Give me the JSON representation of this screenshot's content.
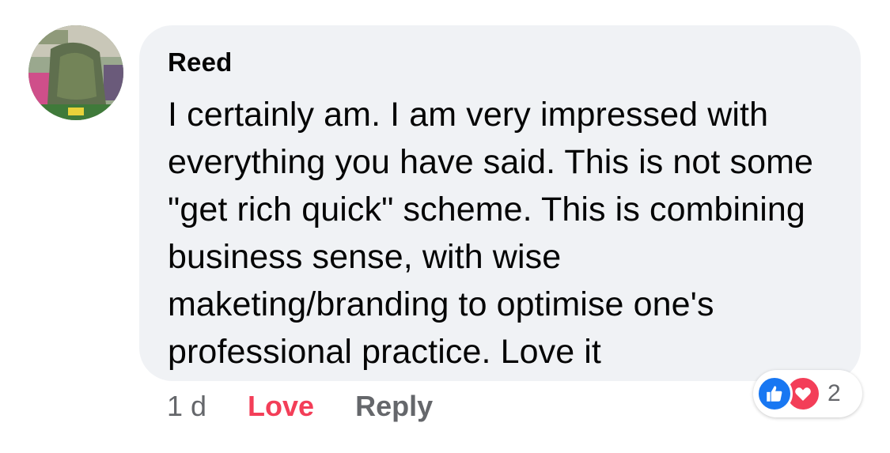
{
  "comment": {
    "author": "Reed",
    "text": "I certainly am. I am very impressed with everything you have said. This is not some \"get rich quick\" scheme. This is combining business sense, with wise maketing/branding to optimise one's professional practice. Love it",
    "time": "1 d",
    "love_label": "Love",
    "reply_label": "Reply",
    "reactions": {
      "icons": [
        "like-icon",
        "heart-icon"
      ],
      "count": "2"
    }
  },
  "colors": {
    "bubble": "#f0f2f5",
    "love": "#f33e58",
    "like": "#1877f2",
    "muted": "#65676b"
  }
}
